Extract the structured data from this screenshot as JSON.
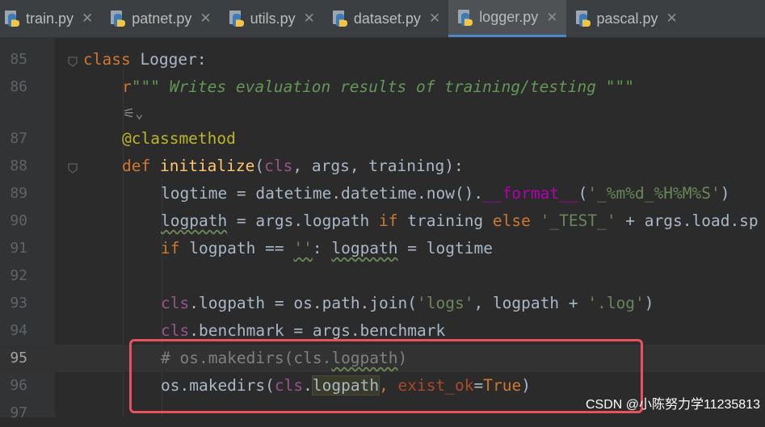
{
  "tabs": [
    {
      "label": "train.py",
      "active": false
    },
    {
      "label": "patnet.py",
      "active": false
    },
    {
      "label": "utils.py",
      "active": false
    },
    {
      "label": "dataset.py",
      "active": false
    },
    {
      "label": "logger.py",
      "active": true
    },
    {
      "label": "pascal.py",
      "active": false
    }
  ],
  "close_glyph": "✕",
  "line_numbers": {
    "l85": "85",
    "l86": "86",
    "l87": "87",
    "l88": "88",
    "l89": "89",
    "l90": "90",
    "l91": "91",
    "l92": "92",
    "l93": "93",
    "l94": "94",
    "l95": "95",
    "l96": "96",
    "l97": "97"
  },
  "code": {
    "l85": {
      "kw": "class",
      "rest": " Logger:"
    },
    "l86": {
      "prefix": "r",
      "doc": "\"\"\" Writes evaluation results of training/testing \"\"\""
    },
    "l87": {
      "deco": "@classmethod"
    },
    "l88": {
      "kw": "def",
      "fn": "initialize",
      "open": "(",
      "self": "cls",
      "rest": ", args, training):"
    },
    "l89": {
      "a": "logtime = datetime.datetime.now().",
      "magic": "__format__",
      "b": "(",
      "str": "'_%m%d_%H%M%S'",
      "c": ")"
    },
    "l90": {
      "var": "logpath",
      "a": " = args.logpath ",
      "kw1": "if",
      "b": " training ",
      "kw2": "else",
      "c": " ",
      "str": "'_TEST_'",
      "d": " + args.load.sp"
    },
    "l91": {
      "kw": "if",
      "a": " logpath == ",
      "str": "''",
      "b": ": ",
      "var": "logpath",
      "c": " = logtime"
    },
    "l93": {
      "self": "cls",
      "a": ".logpath = os.path.join(",
      "str1": "'logs'",
      "b": ", logpath + ",
      "str2": "'.log'",
      "c": ")"
    },
    "l94": {
      "self": "cls",
      "a": ".benchmark = args.benchmark"
    },
    "l95": {
      "a": "# os.makedirs(cls.",
      "var": "logpath",
      "b": ")"
    },
    "l96": {
      "a": "os.makedirs(",
      "self": "cls",
      "b": ".",
      "var": "logpath",
      "c": ", ",
      "param": "exist_ok",
      "d": "=",
      "kw": "True",
      "e": ")"
    }
  },
  "inlay_hint": "⚟⌄",
  "watermark": "CSDN @小陈努力学11235813",
  "colors": {
    "background": "#2b2b2b",
    "gutter": "#313335",
    "tabbar": "#3c3f41",
    "highlight_box": "#e9515e"
  }
}
